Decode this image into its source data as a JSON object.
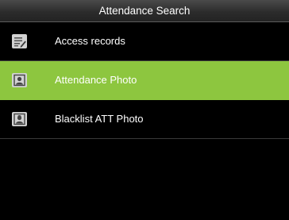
{
  "header": {
    "title": "Attendance Search"
  },
  "menu": {
    "items": [
      {
        "label": "Access records",
        "icon": "records-list-icon",
        "selected": false
      },
      {
        "label": "Attendance Photo",
        "icon": "portrait-photo-icon",
        "selected": true
      },
      {
        "label": "Blacklist ATT Photo",
        "icon": "blacklist-photo-icon",
        "selected": false
      }
    ]
  },
  "colors": {
    "background": "#000000",
    "selected_row": "#8dc63f",
    "text": "#ffffff",
    "icon": "#d2d2d2"
  }
}
